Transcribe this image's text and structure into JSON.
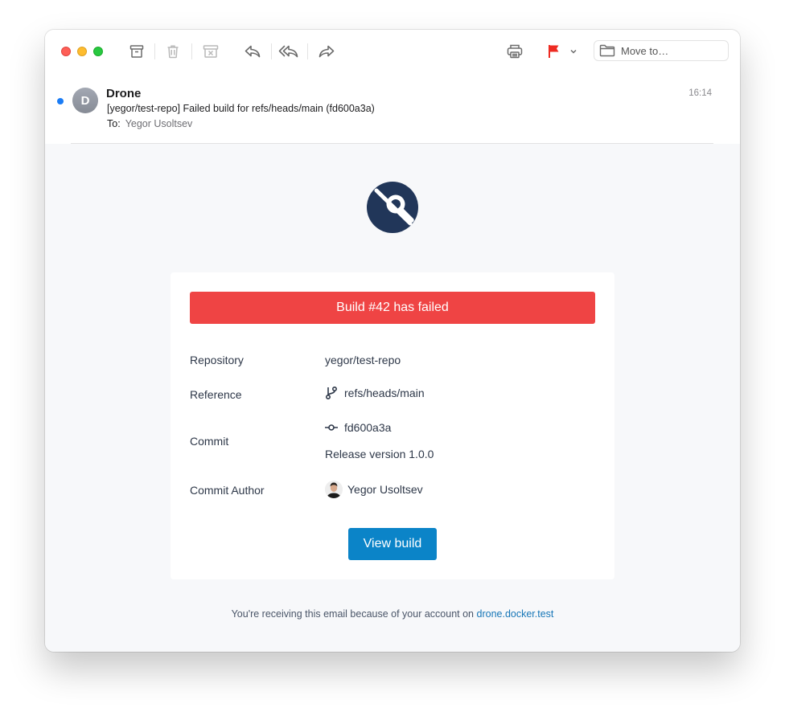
{
  "toolbar": {
    "move_to_placeholder": "Move to…",
    "flag_color": "#ee2b22"
  },
  "message": {
    "sender": "Drone",
    "avatar_letter": "D",
    "subject": "[yegor/test-repo] Failed build for refs/heads/main (fd600a3a)",
    "to_label": "To:",
    "to_name": "Yegor Usoltsev",
    "time": "16:14"
  },
  "email": {
    "banner": "Build #42 has failed",
    "banner_color": "#ef4444",
    "rows": {
      "repository_label": "Repository",
      "repository_value": "yegor/test-repo",
      "reference_label": "Reference",
      "reference_value": "refs/heads/main",
      "commit_label": "Commit",
      "commit_hash": "fd600a3a",
      "commit_message": "Release version 1.0.0",
      "author_label": "Commit Author",
      "author_value": "Yegor Usoltsev"
    },
    "button": "View build",
    "button_color": "#0b84c8",
    "footer_text": "You're receiving this email because of your account on",
    "footer_link": "drone.docker.test"
  }
}
